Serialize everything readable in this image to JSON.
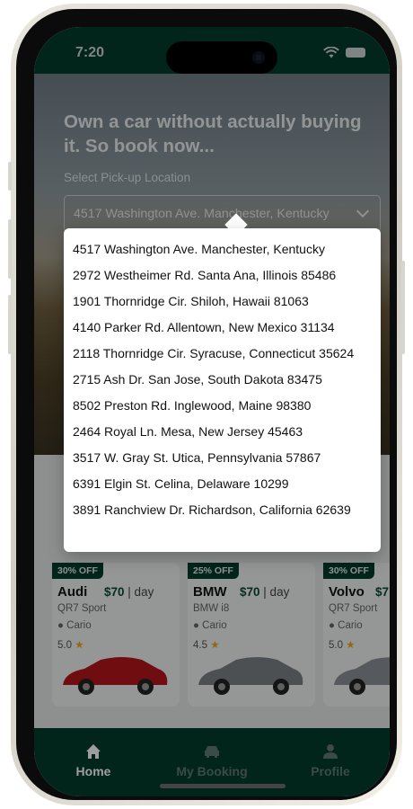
{
  "status": {
    "time": "7:20"
  },
  "hero": {
    "headline": "Own a car without actually buying it. So book now...",
    "pickup_label": "Select Pick-up Location",
    "pickup_selected": "4517 Washington Ave. Manchester, Kentucky"
  },
  "dropdown": {
    "options": [
      "4517 Washington Ave. Manchester, Kentucky",
      "2972 Westheimer Rd. Santa Ana, Illinois 85486",
      "1901 Thornridge Cir. Shiloh, Hawaii 81063",
      "4140 Parker Rd. Allentown, New Mexico 31134",
      "2118 Thornridge Cir. Syracuse, Connecticut 35624",
      "2715 Ash Dr. San Jose, South Dakota 83475",
      "8502 Preston Rd. Inglewood, Maine 98380",
      "2464 Royal Ln. Mesa, New Jersey 45463",
      "3517 W. Gray St. Utica, Pennsylvania 57867",
      "6391 Elgin St. Celina, Delaware 10299",
      "3891 Ranchview Dr. Richardson, California 62639"
    ]
  },
  "cars": [
    {
      "badge": "30% OFF",
      "brand": "Audi",
      "price": "$70",
      "per": "| day",
      "model": "QR7 Sport",
      "location": "Cario",
      "rating": "5.0",
      "color": "#b3161b"
    },
    {
      "badge": "25% OFF",
      "brand": "BMW",
      "price": "$70",
      "per": "| day",
      "model": "BMW i8",
      "location": "Cario",
      "rating": "4.5",
      "color": "#7d8187"
    },
    {
      "badge": "30% OFF",
      "brand": "Volvo",
      "price": "$7",
      "per": "",
      "model": "QR7 Sport",
      "location": "Cario",
      "rating": "5.0",
      "color": "#8c9096"
    }
  ],
  "nav": {
    "items": [
      {
        "label": "Home",
        "icon": "home-icon",
        "active": true
      },
      {
        "label": "My Booking",
        "icon": "car-icon",
        "active": false
      },
      {
        "label": "Profile",
        "icon": "person-icon",
        "active": false
      }
    ]
  },
  "colors": {
    "primary": "#023a2c",
    "star": "#f4a418"
  }
}
